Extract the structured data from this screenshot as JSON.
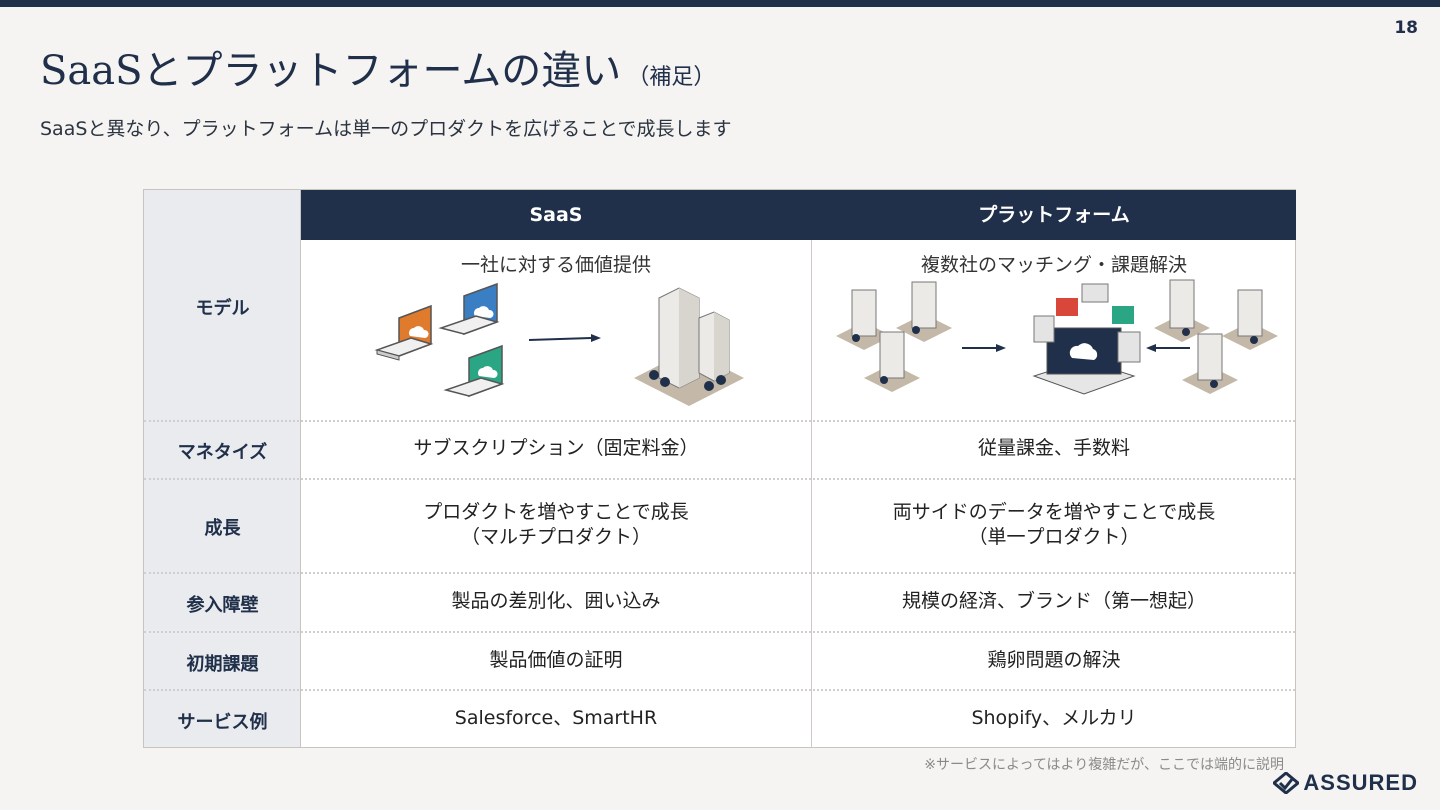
{
  "page_number": "18",
  "title": "SaaSとプラットフォームの違い",
  "title_suffix": "（補足）",
  "subtitle": "SaaSと異なり、プラットフォームは単一のプロダクトを広げることで成長します",
  "table": {
    "headers": {
      "saas": "SaaS",
      "platform": "プラットフォーム"
    },
    "model": {
      "label": "モデル",
      "saas_caption": "一社に対する価値提供",
      "platform_caption": "複数社のマッチング・課題解決"
    },
    "rows": [
      {
        "label": "マネタイズ",
        "saas": "サブスクリプション（固定料金）",
        "platform": "従量課金、手数料"
      },
      {
        "label": "成長",
        "saas_line1": "プロダクトを増やすことで成長",
        "saas_line2": "（マルチプロダクト）",
        "platform_line1": "両サイドのデータを増やすことで成長",
        "platform_line2": "（単一プロダクト）"
      },
      {
        "label": "参入障壁",
        "saas": "製品の差別化、囲い込み",
        "platform": "規模の経済、ブランド（第一想起）"
      },
      {
        "label": "初期課題",
        "saas": "製品価値の証明",
        "platform": "鶏卵問題の解決"
      },
      {
        "label": "サービス例",
        "saas": "Salesforce、SmartHR",
        "platform": "Shopify、メルカリ"
      }
    ]
  },
  "footnote": "※サービスによってはより複雑だが、ここでは端的に説明",
  "logo_text": "ASSURED",
  "colors": {
    "navy": "#20304a",
    "orange": "#e07a2c",
    "blue": "#3a7fc4",
    "teal": "#2aa685",
    "red": "#d9473b",
    "label_bg": "#e9ebef"
  }
}
